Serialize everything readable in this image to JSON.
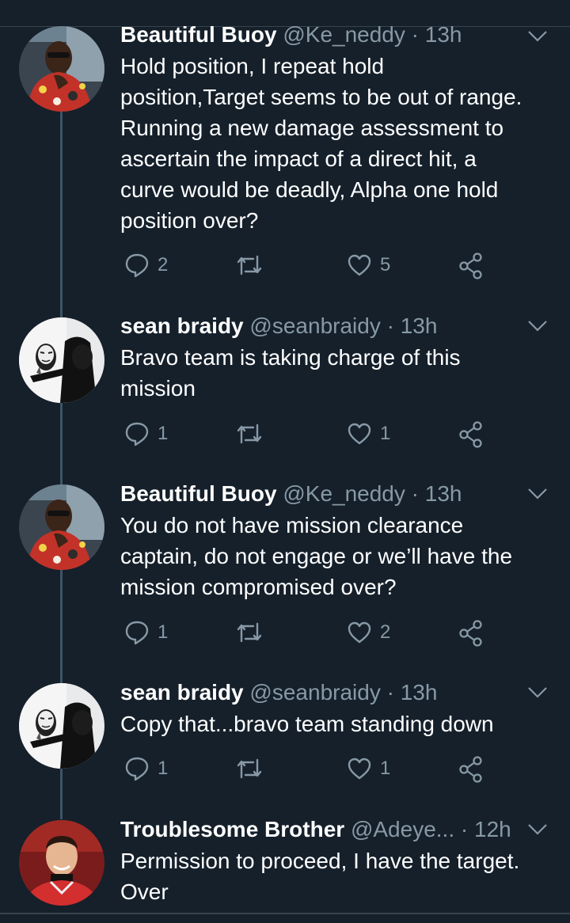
{
  "tweets": [
    {
      "name": "Beautiful Buoy",
      "handle": "@Ke_neddy",
      "dot": "·",
      "time": "13h",
      "avatar": "man-with-sunglasses-avatar",
      "lines": [
        "Hold position, I repeat hold",
        "position,Target seems to be out of range.",
        "Running a new damage assessment to",
        "ascertain the impact of a direct hit, a",
        "curve would be deadly, Alpha one hold",
        "position over?"
      ],
      "replies": "2",
      "retweets": "",
      "likes": "5"
    },
    {
      "name": "sean braidy",
      "handle": "@seanbraidy",
      "dot": "·",
      "time": "13h",
      "avatar": "hooded-mask-avatar",
      "lines": [
        "Bravo team is taking charge of this",
        "mission"
      ],
      "replies": "1",
      "retweets": "",
      "likes": "1"
    },
    {
      "name": "Beautiful Buoy",
      "handle": "@Ke_neddy",
      "dot": "·",
      "time": "13h",
      "avatar": "man-with-sunglasses-avatar",
      "lines": [
        "You do not have mission clearance",
        "captain, do not engage or we’ll have the",
        "mission compromised over?"
      ],
      "replies": "1",
      "retweets": "",
      "likes": "2"
    },
    {
      "name": "sean braidy",
      "handle": "@seanbraidy",
      "dot": "·",
      "time": "13h",
      "avatar": "hooded-mask-avatar",
      "lines": [
        "Copy that...bravo team standing down"
      ],
      "replies": "1",
      "retweets": "",
      "likes": "1"
    },
    {
      "name": "Troublesome Brother",
      "handle": "@Adeye...",
      "dot": "·",
      "time": "12h",
      "avatar": "footballer-avatar",
      "lines": [
        "Permission to proceed, I have the target.",
        "Over"
      ]
    }
  ],
  "icons": {
    "reply": "reply-icon",
    "retweet": "retweet-icon",
    "like": "heart-icon",
    "share": "share-icon",
    "menu": "chevron-down-icon"
  },
  "colors": {
    "background": "#15202b",
    "secondary_text": "#8899a6",
    "thread_line": "#3d5466",
    "divider": "#38444d"
  }
}
